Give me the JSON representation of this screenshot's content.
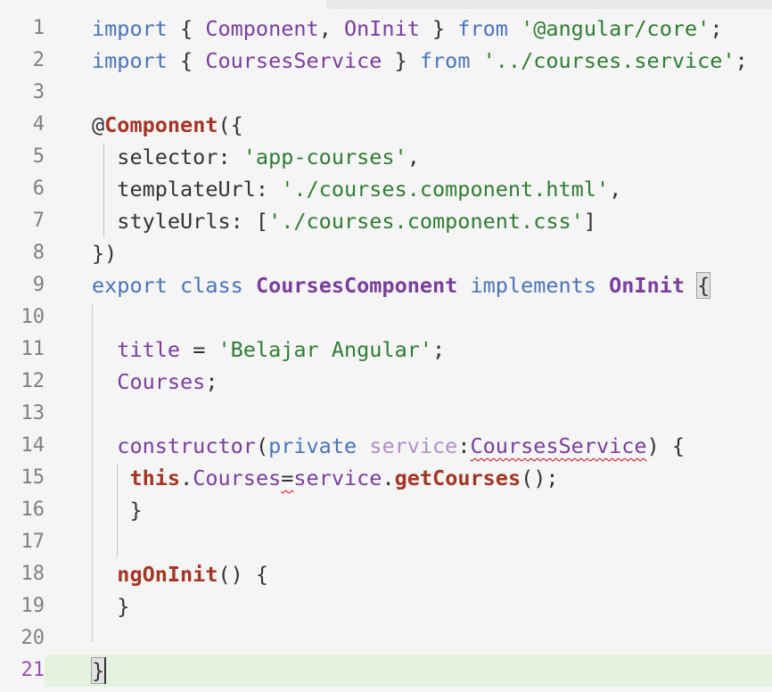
{
  "editor": {
    "current_line": "21",
    "lines": [
      {
        "no": "1",
        "tokens": [
          {
            "t": "import",
            "c": "kw"
          },
          {
            "t": " { ",
            "c": "pn"
          },
          {
            "t": "Component",
            "c": "ty"
          },
          {
            "t": ", ",
            "c": "pn"
          },
          {
            "t": "OnInit",
            "c": "ty"
          },
          {
            "t": " } ",
            "c": "pn"
          },
          {
            "t": "from",
            "c": "kw"
          },
          {
            "t": " ",
            "c": "pn"
          },
          {
            "t": "'@angular/core'",
            "c": "str"
          },
          {
            "t": ";",
            "c": "pn"
          }
        ]
      },
      {
        "no": "2",
        "tokens": [
          {
            "t": "import",
            "c": "kw"
          },
          {
            "t": " { ",
            "c": "pn"
          },
          {
            "t": "CoursesService",
            "c": "ty"
          },
          {
            "t": " } ",
            "c": "pn"
          },
          {
            "t": "from",
            "c": "kw"
          },
          {
            "t": " ",
            "c": "pn"
          },
          {
            "t": "'../courses.service'",
            "c": "str"
          },
          {
            "t": ";",
            "c": "pn"
          }
        ]
      },
      {
        "no": "3",
        "tokens": []
      },
      {
        "no": "4",
        "tokens": [
          {
            "t": "@",
            "c": "pn"
          },
          {
            "t": "Component",
            "c": "fn"
          },
          {
            "t": "({",
            "c": "pn"
          }
        ]
      },
      {
        "no": "5",
        "tokens": [
          {
            "t": "  selector: ",
            "c": "pn"
          },
          {
            "t": "'app-courses'",
            "c": "str"
          },
          {
            "t": ",",
            "c": "pn"
          }
        ]
      },
      {
        "no": "6",
        "tokens": [
          {
            "t": "  templateUrl: ",
            "c": "pn"
          },
          {
            "t": "'./courses.component.html'",
            "c": "str"
          },
          {
            "t": ",",
            "c": "pn"
          }
        ]
      },
      {
        "no": "7",
        "tokens": [
          {
            "t": "  styleUrls: [",
            "c": "pn"
          },
          {
            "t": "'./courses.component.css'",
            "c": "str"
          },
          {
            "t": "]",
            "c": "pn"
          }
        ]
      },
      {
        "no": "8",
        "tokens": [
          {
            "t": "})",
            "c": "pn"
          }
        ]
      },
      {
        "no": "9",
        "tokens": [
          {
            "t": "export",
            "c": "kw"
          },
          {
            "t": " ",
            "c": "pn"
          },
          {
            "t": "class",
            "c": "kw"
          },
          {
            "t": " ",
            "c": "pn"
          },
          {
            "t": "CoursesComponent",
            "c": "tyb"
          },
          {
            "t": " ",
            "c": "pn"
          },
          {
            "t": "implements",
            "c": "kw"
          },
          {
            "t": " ",
            "c": "pn"
          },
          {
            "t": "OnInit",
            "c": "tyb"
          },
          {
            "t": " ",
            "c": "pn"
          },
          {
            "t": "{",
            "c": "pn bracket-box"
          }
        ]
      },
      {
        "no": "10",
        "tokens": []
      },
      {
        "no": "11",
        "tokens": [
          {
            "t": "  ",
            "c": "pn"
          },
          {
            "t": "title",
            "c": "ty"
          },
          {
            "t": " = ",
            "c": "pn"
          },
          {
            "t": "'Belajar Angular'",
            "c": "str"
          },
          {
            "t": ";",
            "c": "pn"
          }
        ]
      },
      {
        "no": "12",
        "tokens": [
          {
            "t": "  ",
            "c": "pn"
          },
          {
            "t": "Courses",
            "c": "ty"
          },
          {
            "t": ";",
            "c": "pn"
          }
        ]
      },
      {
        "no": "13",
        "tokens": []
      },
      {
        "no": "14",
        "tokens": [
          {
            "t": "  ",
            "c": "pn"
          },
          {
            "t": "constructor",
            "c": "ty"
          },
          {
            "t": "(",
            "c": "pn"
          },
          {
            "t": "private",
            "c": "kw"
          },
          {
            "t": " ",
            "c": "pn"
          },
          {
            "t": "service",
            "c": "param"
          },
          {
            "t": ":",
            "c": "pn"
          },
          {
            "t": "CoursesService",
            "c": "ty squig"
          },
          {
            "t": ") {",
            "c": "pn"
          }
        ]
      },
      {
        "no": "15",
        "tokens": [
          {
            "t": "   ",
            "c": "pn"
          },
          {
            "t": "this",
            "c": "fn"
          },
          {
            "t": ".",
            "c": "pn"
          },
          {
            "t": "Courses",
            "c": "ty"
          },
          {
            "t": "=",
            "c": "pn squig"
          },
          {
            "t": "service",
            "c": "ty"
          },
          {
            "t": ".",
            "c": "pn"
          },
          {
            "t": "getCourses",
            "c": "fn"
          },
          {
            "t": "();",
            "c": "pn"
          }
        ]
      },
      {
        "no": "16",
        "tokens": [
          {
            "t": "   }",
            "c": "pn"
          }
        ]
      },
      {
        "no": "17",
        "tokens": []
      },
      {
        "no": "18",
        "tokens": [
          {
            "t": "  ",
            "c": "pn"
          },
          {
            "t": "ngOnInit",
            "c": "fn"
          },
          {
            "t": "() {",
            "c": "pn"
          }
        ]
      },
      {
        "no": "19",
        "tokens": [
          {
            "t": "  }",
            "c": "pn"
          }
        ]
      },
      {
        "no": "20",
        "tokens": []
      },
      {
        "no": "21",
        "tokens": [
          {
            "t": "}",
            "c": "pn bracket-box"
          }
        ]
      }
    ]
  },
  "colors": {
    "keyword": "#4a74b8",
    "type": "#7a3e9d",
    "string": "#2f7d32",
    "function": "#a33624",
    "param": "#b08fc8",
    "current_line_bg": "#e4f3dd",
    "error_squiggle": "#d0021b"
  }
}
